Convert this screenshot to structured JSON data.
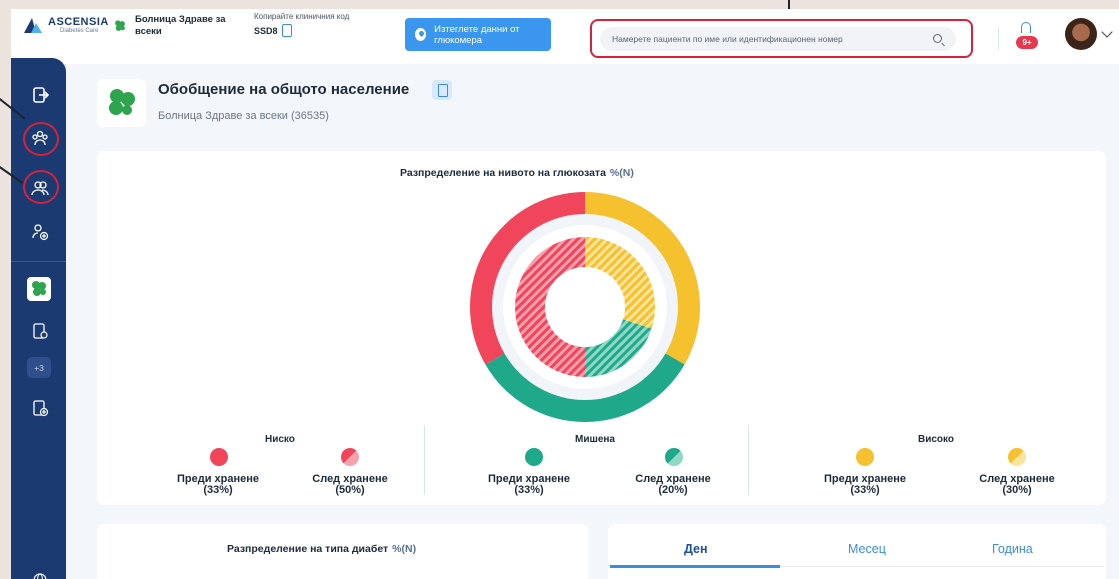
{
  "header": {
    "brand": "ASCENSIA",
    "brand_sub": "Diabetes Care",
    "hospital_name": "Болница Здраве за всеки",
    "copy_label": "Копирайте клиничния код",
    "clinic_code": "SSD8",
    "download_button": "Изтеглете данни от глюкомера",
    "search_placeholder": "Намерете пациенти по име или идентификационен номер",
    "notifications_badge": "9+"
  },
  "sidebar": {
    "items": [
      "exit-icon",
      "population-icon",
      "patients-icon",
      "add-patient-icon",
      "clinic-logo",
      "clinic-settings-icon",
      "more-clinics",
      "add-clinic-icon"
    ],
    "more_count": "+3"
  },
  "page": {
    "title": "Обобщение на общото население",
    "subtitle": "Болница Здраве за всеки  (36535)"
  },
  "glucose_chart": {
    "title": "Разпределение на нивото на глюкозата",
    "unit": "%(N)",
    "groups": [
      {
        "name": "Ниско",
        "color": "#f0455a",
        "before_label": "Преди хранене",
        "before_value": "(33%)",
        "after_label": "След хранене",
        "after_value": "(50%)"
      },
      {
        "name": "Мишена",
        "color": "#1fa98a",
        "before_label": "Преди хранене",
        "before_value": "(33%)",
        "after_label": "След хранене",
        "after_value": "(20%)"
      },
      {
        "name": "Високо",
        "color": "#f5c12e",
        "before_label": "Преди хранене",
        "before_value": "(33%)",
        "after_label": "След хранене",
        "after_value": "(30%)"
      }
    ]
  },
  "chart_data": {
    "type": "pie",
    "title": "Разпределение на нивото на глюкозата",
    "series": [
      {
        "name": "Преди хранене",
        "categories": [
          "Ниско",
          "Мишена",
          "Високо"
        ],
        "values": [
          33,
          33,
          33
        ]
      },
      {
        "name": "След хранене",
        "categories": [
          "Ниско",
          "Мишена",
          "Високо"
        ],
        "values": [
          50,
          20,
          30
        ]
      }
    ],
    "colors": [
      "#f0455a",
      "#1fa98a",
      "#f5c12e"
    ]
  },
  "diabetes_card": {
    "title": "Разпределение на типа диабет",
    "unit": "%(N)"
  },
  "period_tabs": [
    "Ден",
    "Месец",
    "Година"
  ]
}
